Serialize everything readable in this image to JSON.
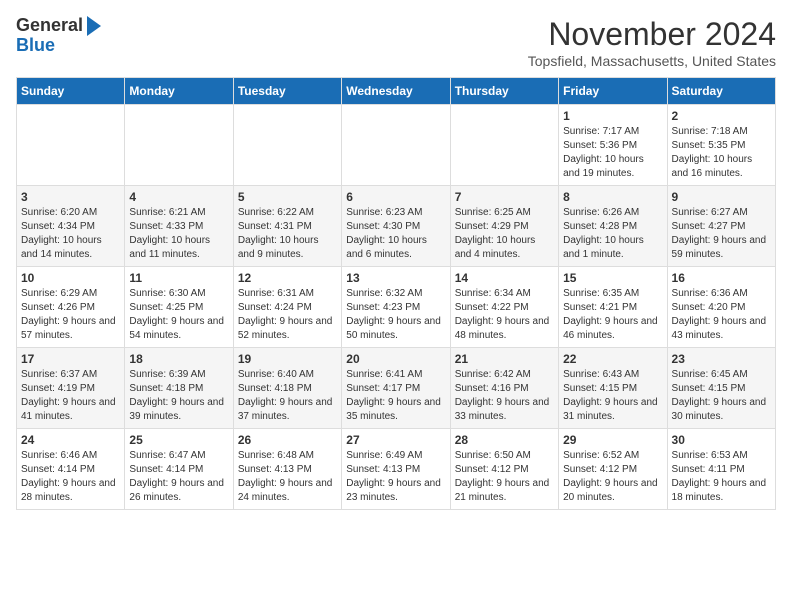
{
  "logo": {
    "line1": "General",
    "line2": "Blue"
  },
  "title": "November 2024",
  "location": "Topsfield, Massachusetts, United States",
  "weekdays": [
    "Sunday",
    "Monday",
    "Tuesday",
    "Wednesday",
    "Thursday",
    "Friday",
    "Saturday"
  ],
  "weeks": [
    [
      {
        "day": "",
        "info": ""
      },
      {
        "day": "",
        "info": ""
      },
      {
        "day": "",
        "info": ""
      },
      {
        "day": "",
        "info": ""
      },
      {
        "day": "",
        "info": ""
      },
      {
        "day": "1",
        "info": "Sunrise: 7:17 AM\nSunset: 5:36 PM\nDaylight: 10 hours and 19 minutes."
      },
      {
        "day": "2",
        "info": "Sunrise: 7:18 AM\nSunset: 5:35 PM\nDaylight: 10 hours and 16 minutes."
      }
    ],
    [
      {
        "day": "3",
        "info": "Sunrise: 6:20 AM\nSunset: 4:34 PM\nDaylight: 10 hours and 14 minutes."
      },
      {
        "day": "4",
        "info": "Sunrise: 6:21 AM\nSunset: 4:33 PM\nDaylight: 10 hours and 11 minutes."
      },
      {
        "day": "5",
        "info": "Sunrise: 6:22 AM\nSunset: 4:31 PM\nDaylight: 10 hours and 9 minutes."
      },
      {
        "day": "6",
        "info": "Sunrise: 6:23 AM\nSunset: 4:30 PM\nDaylight: 10 hours and 6 minutes."
      },
      {
        "day": "7",
        "info": "Sunrise: 6:25 AM\nSunset: 4:29 PM\nDaylight: 10 hours and 4 minutes."
      },
      {
        "day": "8",
        "info": "Sunrise: 6:26 AM\nSunset: 4:28 PM\nDaylight: 10 hours and 1 minute."
      },
      {
        "day": "9",
        "info": "Sunrise: 6:27 AM\nSunset: 4:27 PM\nDaylight: 9 hours and 59 minutes."
      }
    ],
    [
      {
        "day": "10",
        "info": "Sunrise: 6:29 AM\nSunset: 4:26 PM\nDaylight: 9 hours and 57 minutes."
      },
      {
        "day": "11",
        "info": "Sunrise: 6:30 AM\nSunset: 4:25 PM\nDaylight: 9 hours and 54 minutes."
      },
      {
        "day": "12",
        "info": "Sunrise: 6:31 AM\nSunset: 4:24 PM\nDaylight: 9 hours and 52 minutes."
      },
      {
        "day": "13",
        "info": "Sunrise: 6:32 AM\nSunset: 4:23 PM\nDaylight: 9 hours and 50 minutes."
      },
      {
        "day": "14",
        "info": "Sunrise: 6:34 AM\nSunset: 4:22 PM\nDaylight: 9 hours and 48 minutes."
      },
      {
        "day": "15",
        "info": "Sunrise: 6:35 AM\nSunset: 4:21 PM\nDaylight: 9 hours and 46 minutes."
      },
      {
        "day": "16",
        "info": "Sunrise: 6:36 AM\nSunset: 4:20 PM\nDaylight: 9 hours and 43 minutes."
      }
    ],
    [
      {
        "day": "17",
        "info": "Sunrise: 6:37 AM\nSunset: 4:19 PM\nDaylight: 9 hours and 41 minutes."
      },
      {
        "day": "18",
        "info": "Sunrise: 6:39 AM\nSunset: 4:18 PM\nDaylight: 9 hours and 39 minutes."
      },
      {
        "day": "19",
        "info": "Sunrise: 6:40 AM\nSunset: 4:18 PM\nDaylight: 9 hours and 37 minutes."
      },
      {
        "day": "20",
        "info": "Sunrise: 6:41 AM\nSunset: 4:17 PM\nDaylight: 9 hours and 35 minutes."
      },
      {
        "day": "21",
        "info": "Sunrise: 6:42 AM\nSunset: 4:16 PM\nDaylight: 9 hours and 33 minutes."
      },
      {
        "day": "22",
        "info": "Sunrise: 6:43 AM\nSunset: 4:15 PM\nDaylight: 9 hours and 31 minutes."
      },
      {
        "day": "23",
        "info": "Sunrise: 6:45 AM\nSunset: 4:15 PM\nDaylight: 9 hours and 30 minutes."
      }
    ],
    [
      {
        "day": "24",
        "info": "Sunrise: 6:46 AM\nSunset: 4:14 PM\nDaylight: 9 hours and 28 minutes."
      },
      {
        "day": "25",
        "info": "Sunrise: 6:47 AM\nSunset: 4:14 PM\nDaylight: 9 hours and 26 minutes."
      },
      {
        "day": "26",
        "info": "Sunrise: 6:48 AM\nSunset: 4:13 PM\nDaylight: 9 hours and 24 minutes."
      },
      {
        "day": "27",
        "info": "Sunrise: 6:49 AM\nSunset: 4:13 PM\nDaylight: 9 hours and 23 minutes."
      },
      {
        "day": "28",
        "info": "Sunrise: 6:50 AM\nSunset: 4:12 PM\nDaylight: 9 hours and 21 minutes."
      },
      {
        "day": "29",
        "info": "Sunrise: 6:52 AM\nSunset: 4:12 PM\nDaylight: 9 hours and 20 minutes."
      },
      {
        "day": "30",
        "info": "Sunrise: 6:53 AM\nSunset: 4:11 PM\nDaylight: 9 hours and 18 minutes."
      }
    ]
  ]
}
